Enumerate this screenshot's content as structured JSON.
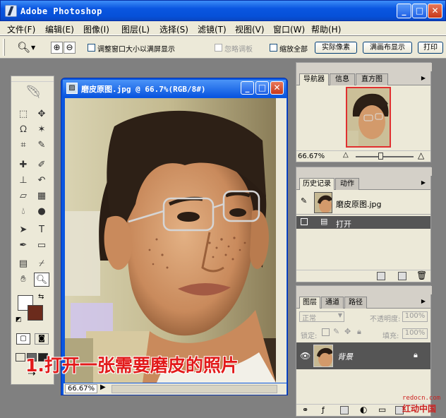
{
  "app": {
    "title": "Adobe Photoshop"
  },
  "menu": [
    "文件(F)",
    "编辑(E)",
    "图像(I)",
    "图层(L)",
    "选择(S)",
    "滤镜(T)",
    "视图(V)",
    "窗口(W)",
    "帮助(H)"
  ],
  "options": {
    "zoom_resize": "调整窗口大小以满屏显示",
    "ignore_palettes": "忽略调板",
    "zoom_all": "缩放全部",
    "actual_pixels": "实际像素",
    "fit_screen": "满画布显示",
    "print_size": "打印"
  },
  "document": {
    "title": "磨皮原图.jpg @ 66.7%(RGB/8#)",
    "zoom": "66.67%"
  },
  "navigator": {
    "tabs": [
      "导航器",
      "信息",
      "直方图"
    ],
    "zoom": "66.67%"
  },
  "history": {
    "tabs": [
      "历史记录",
      "动作"
    ],
    "snapshot": "磨皮原图.jpg",
    "items": [
      "打开"
    ]
  },
  "layers": {
    "tabs": [
      "图层",
      "通道",
      "路径"
    ],
    "blend_mode": "正常",
    "opacity_label": "不透明度:",
    "opacity": "100%",
    "lock_label": "锁定:",
    "fill_label": "填充:",
    "fill": "100%",
    "layer_name": "背景"
  },
  "caption": "1.打开一张需要磨皮的照片",
  "watermark": {
    "url": "redocn.com",
    "name": "红动中国"
  }
}
